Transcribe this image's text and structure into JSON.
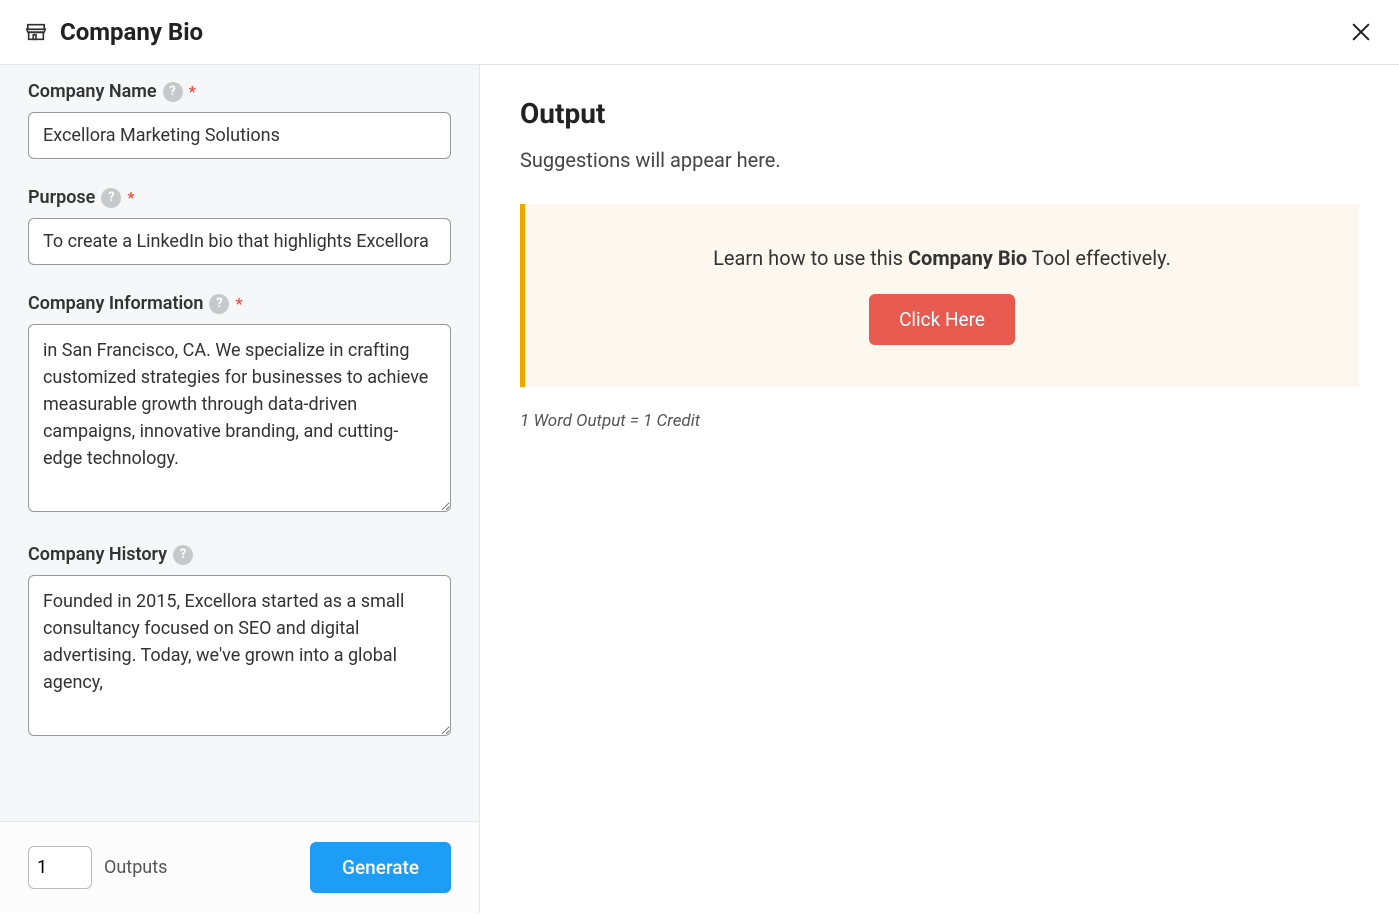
{
  "header": {
    "title": "Company Bio"
  },
  "form": {
    "company_name": {
      "label": "Company Name",
      "value": "Excellora Marketing Solutions",
      "required": true
    },
    "purpose": {
      "label": "Purpose",
      "value": "To create a LinkedIn bio that highlights Excellora",
      "required": true
    },
    "company_information": {
      "label": "Company Information",
      "value": "in San Francisco, CA. We specialize in crafting customized strategies for businesses to achieve measurable growth through data-driven campaigns, innovative branding, and cutting-edge technology.",
      "required": true
    },
    "company_history": {
      "label": "Company History",
      "value": "Founded in 2015, Excellora started as a small consultancy focused on SEO and digital advertising. Today, we've grown into a global agency, ",
      "required": false
    }
  },
  "bottom": {
    "outputs_count": "1",
    "outputs_label": "Outputs",
    "generate_label": "Generate"
  },
  "output": {
    "title": "Output",
    "suggestions_placeholder": "Suggestions will appear here.",
    "learn_prefix": "Learn how to use this ",
    "learn_bold": "Company Bio",
    "learn_suffix": " Tool effectively.",
    "click_here_label": "Click Here",
    "credit_text": "1 Word Output = 1 Credit"
  }
}
